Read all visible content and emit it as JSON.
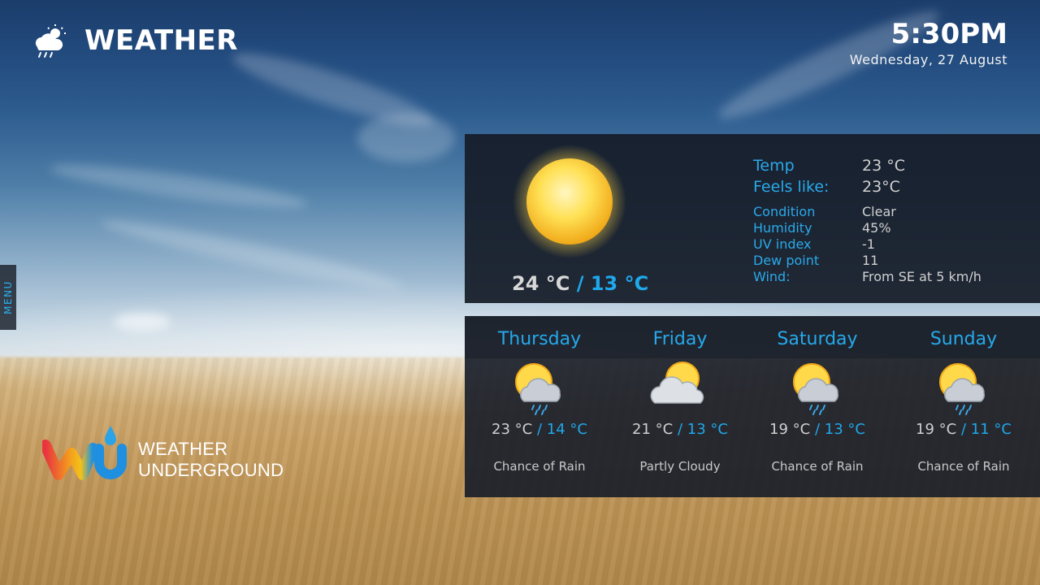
{
  "header": {
    "title": "WEATHER"
  },
  "clock": {
    "time": "5:30PM",
    "date": "Wednesday, 27 August"
  },
  "menu": {
    "label": "MENU"
  },
  "branding": {
    "line1": "WEATHER",
    "line2": "UNDERGROUND"
  },
  "current": {
    "icon": "sun-icon",
    "high": "24 °C",
    "separator": " / ",
    "low": "13 °C",
    "temp_label": "Temp",
    "temp_value": "23 °C",
    "feels_label": "Feels like:",
    "feels_value": "23°C",
    "condition_label": "Condition",
    "condition_value": "Clear",
    "humidity_label": "Humidity",
    "humidity_value": "45%",
    "uv_label": "UV index",
    "uv_value": "-1",
    "dew_label": "Dew point",
    "dew_value": "11",
    "wind_label": "Wind:",
    "wind_value": "From SE at 5 km/h"
  },
  "forecast": [
    {
      "day": "Thursday",
      "icon": "sun-cloud-rain-icon",
      "high": "23 °C",
      "low": "14 °C",
      "condition": "Chance of Rain"
    },
    {
      "day": "Friday",
      "icon": "partly-cloudy-icon",
      "high": "21 °C",
      "low": "13 °C",
      "condition": "Partly Cloudy"
    },
    {
      "day": "Saturday",
      "icon": "sun-cloud-rain-icon",
      "high": "19 °C",
      "low": "13 °C",
      "condition": "Chance of Rain"
    },
    {
      "day": "Sunday",
      "icon": "sun-cloud-rain-icon",
      "high": "19 °C",
      "low": "11 °C",
      "condition": "Chance of Rain"
    }
  ],
  "colors": {
    "accent": "#1fa8ec",
    "panel": "#161c28"
  }
}
